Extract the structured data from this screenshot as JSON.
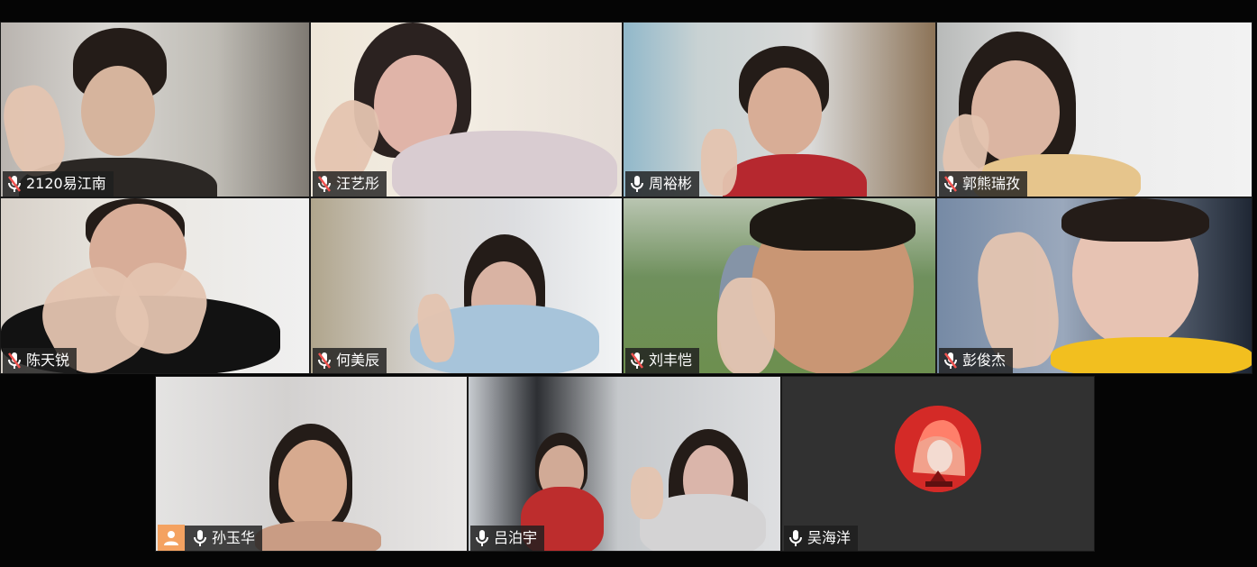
{
  "window": {
    "title": ""
  },
  "participants": [
    {
      "name": "2120易江南",
      "mic": "muted",
      "bg": "#c7c3bd"
    },
    {
      "name": "汪艺彤",
      "mic": "muted",
      "bg": "#e7e1d9"
    },
    {
      "name": "周裕彬",
      "mic": "on",
      "bg": "#c9d1d3"
    },
    {
      "name": "郭熊瑞孜",
      "mic": "muted",
      "bg": "#dfe0df"
    },
    {
      "name": "陈天锐",
      "mic": "muted",
      "bg": "#d6d4cf"
    },
    {
      "name": "何美辰",
      "mic": "muted",
      "bg": "#c5bea8"
    },
    {
      "name": "刘丰恺",
      "mic": "muted",
      "bg": "#8aa36b"
    },
    {
      "name": "彭俊杰",
      "mic": "muted",
      "bg": "#8fa2b7"
    },
    {
      "name": "孙玉华",
      "mic": "on",
      "bg": "#d8d6d5",
      "host": true
    },
    {
      "name": "吕泊宇",
      "mic": "on",
      "bg": "#d1d4d6"
    },
    {
      "name": "吴海洋",
      "mic": "on",
      "bg": "#313131",
      "avatar": true
    }
  ],
  "icons": {
    "mic_on": "microphone-icon",
    "mic_muted": "microphone-muted-icon",
    "host": "host-person-icon"
  },
  "colors": {
    "label_bg": "#1e1e1e",
    "muted_red": "#ef5350",
    "host_badge": "#f4a261"
  }
}
